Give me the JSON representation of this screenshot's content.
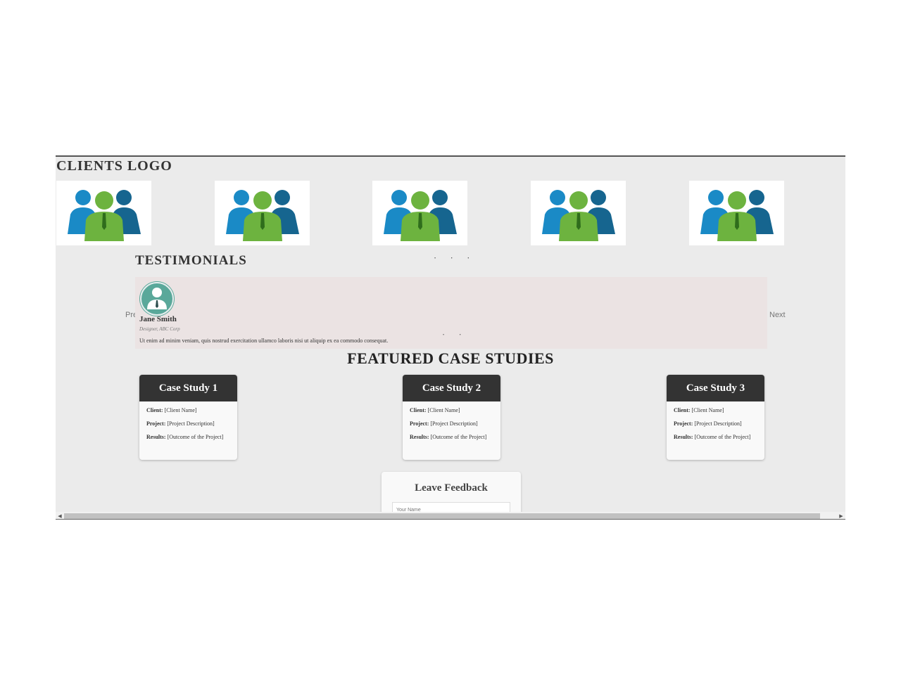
{
  "clients": {
    "title": "CLIENTS LOGO",
    "logos": [
      "people-group-logo-icon",
      "people-group-logo-icon",
      "people-group-logo-icon",
      "people-group-logo-icon",
      "people-group-logo-icon"
    ],
    "carousel_dots": "• • •"
  },
  "testimonials": {
    "title": "TESTIMONIALS",
    "name": "Jane Smith",
    "role": "Designer, ABC Corp",
    "quote": "Ut enim ad minim veniam, quis nostrud exercitation ullamco laboris nisi ut aliquip ex ea commodo consequat.",
    "dots": "• •",
    "prev_label": "Prev",
    "next_label": "Next"
  },
  "featured": {
    "title": "FEATURED CASE STUDIES",
    "client_label": "Client:",
    "project_label": "Project:",
    "results_label": "Results:",
    "cases": [
      {
        "title": "Case Study 1",
        "client": " [Client Name]",
        "project": " [Project Description]",
        "results": " [Outcome of the Project]"
      },
      {
        "title": "Case Study 2",
        "client": " [Client Name]",
        "project": " [Project Description]",
        "results": " [Outcome of the Project]"
      },
      {
        "title": "Case Study 3",
        "client": " [Client Name]",
        "project": " [Project Description]",
        "results": " [Outcome of the Project]"
      }
    ]
  },
  "feedback": {
    "title": "Leave Feedback",
    "name_placeholder": "Your Name"
  },
  "colors": {
    "logo_blue": "#1a8ac6",
    "logo_dark_blue": "#16658f",
    "logo_green": "#6db33f",
    "avatar_teal": "#5aa89a",
    "case_header": "#333333"
  }
}
